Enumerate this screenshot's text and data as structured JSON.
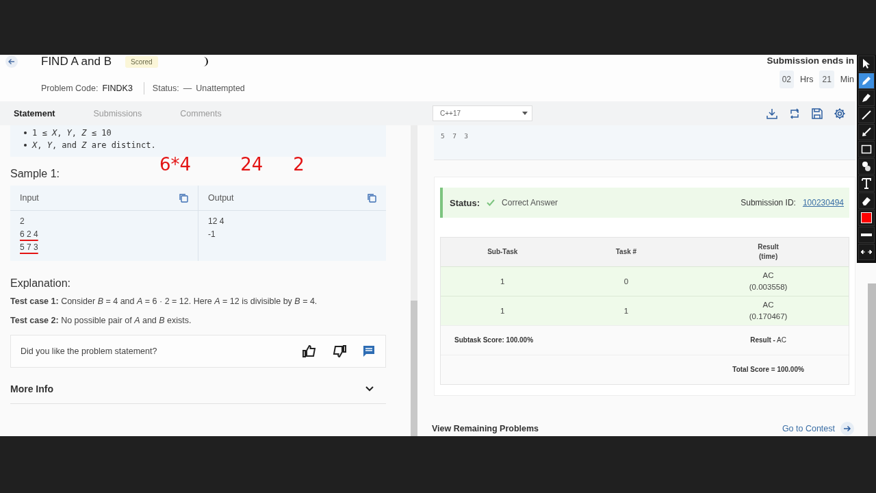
{
  "header": {
    "title": "FIND A and B",
    "badge": "Scored",
    "problem_code_label": "Problem Code:",
    "problem_code": "FINDK3",
    "status_label": "Status:",
    "status_dash": "—",
    "status_value": "Unattempted",
    "timer_label": "Submission ends in",
    "timer": [
      {
        "value": "02",
        "unit": "Hrs"
      },
      {
        "value": "21",
        "unit": "Min"
      }
    ]
  },
  "tabs": [
    {
      "label": "Statement",
      "selected": true
    },
    {
      "label": "Submissions",
      "selected": false
    },
    {
      "label": "Comments",
      "selected": false
    }
  ],
  "editor": {
    "language": "C++17",
    "input_text": "5  7  3"
  },
  "statement": {
    "constraints": [
      "1 ≤ *X*, *Y*, *Z* ≤ 10",
      "*X*, *Y*, and *Z* are distinct."
    ],
    "sample_title": "Sample 1:",
    "input_label": "Input",
    "output_label": "Output",
    "input_lines": [
      {
        "text": "2",
        "underlined": false
      },
      {
        "text": "6 2 4",
        "underlined": true
      },
      {
        "text": "5 7 3",
        "underlined": true
      }
    ],
    "output_lines": [
      "12 4",
      "-1"
    ],
    "explanation_title": "Explanation:",
    "explanation": [
      "**Test case 1:** Consider *B* = 4 and *A* = 6 · 2 = 12. Here *A* = 12 is divisible by *B* = 4.",
      "**Test case 2:** No possible pair of *A* and *B* exists."
    ],
    "feedback_prompt": "Did you like the problem statement?",
    "more_info": "More Info"
  },
  "annotations": [
    "6*4",
    "24",
    "2"
  ],
  "result": {
    "status_label": "Status:",
    "status_value": "Correct Answer",
    "submission_label": "Submission ID:",
    "submission_id": "100230494",
    "columns": [
      {
        "label": "Sub-Task"
      },
      {
        "label": "Task #"
      },
      {
        "label": "Result",
        "sub": "(time)"
      }
    ],
    "rows": [
      {
        "subtask": "1",
        "task": "0",
        "result": "AC",
        "time": "(0.003558)"
      },
      {
        "subtask": "1",
        "task": "1",
        "result": "AC",
        "time": "(0.170467)"
      }
    ],
    "subtask_score": "Subtask Score: 100.00%",
    "result_summary": "**Result -** AC",
    "total_score": "Total Score = 100.00%"
  },
  "footer": {
    "view_remaining": "View Remaining Problems",
    "go_to_contest": "Go to Contest"
  },
  "drawing_toolbar": [
    {
      "kind": "cursor",
      "selected": false
    },
    {
      "kind": "pen",
      "selected": true
    },
    {
      "kind": "highlighter",
      "selected": false
    },
    {
      "kind": "line",
      "selected": false
    },
    {
      "kind": "arrow",
      "selected": false
    },
    {
      "kind": "rectangle",
      "selected": false
    },
    {
      "kind": "numbering",
      "selected": false
    },
    {
      "kind": "text",
      "selected": false
    },
    {
      "kind": "eraser",
      "selected": false
    },
    {
      "kind": "color",
      "selected": false,
      "color": "#ff0000"
    },
    {
      "kind": "thickness",
      "selected": false
    },
    {
      "kind": "swap",
      "selected": false
    }
  ]
}
